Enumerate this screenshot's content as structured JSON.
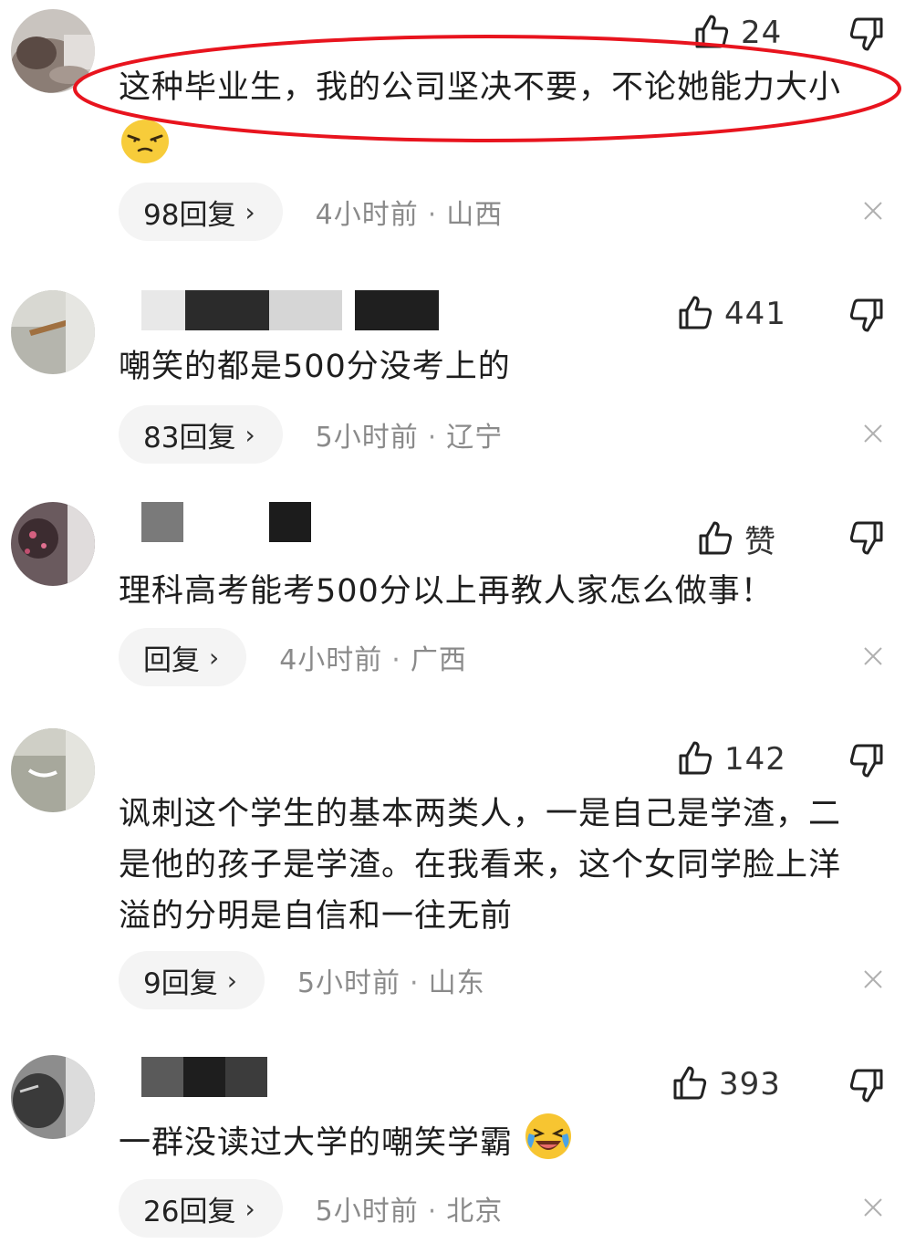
{
  "comments": [
    {
      "text": "这种毕业生，我的公司坚决不要，不论她能力大小",
      "likes": "24",
      "replies": "98回复",
      "time": "4小时前",
      "location": "山西",
      "emoji": "smirk-emoji-icon"
    },
    {
      "text": "嘲笑的都是500分没考上的",
      "likes": "441",
      "replies": "83回复",
      "time": "5小时前",
      "location": "辽宁"
    },
    {
      "text": "理科高考能考500分以上再教人家怎么做事！",
      "likes": "赞",
      "replies": "回复",
      "time": "4小时前",
      "location": "广西"
    },
    {
      "text_lines": [
        "讽刺这个学生的基本两类人，一是自己是学渣，二",
        "是他的孩子是学渣。在我看来，这个女同学脸上洋",
        "溢的分明是自信和一往无前"
      ],
      "likes": "142",
      "replies": "9回复",
      "time": "5小时前",
      "location": "山东"
    },
    {
      "text": "一群没读过大学的嘲笑学霸",
      "likes": "393",
      "replies": "26回复",
      "time": "5小时前",
      "location": "北京",
      "emoji": "laughing-crying-emoji-icon"
    }
  ],
  "meta_separator": "·",
  "reply_chevron": "›",
  "colors": {
    "highlight": "#e8141e",
    "reply_pill_bg": "#f4f4f4",
    "meta_text": "#8a8a8a"
  },
  "icons": {
    "like": "thumbs-up-icon",
    "dislike": "thumbs-down-icon",
    "close": "close-icon",
    "reply_arrow": "chevron-right-icon"
  }
}
